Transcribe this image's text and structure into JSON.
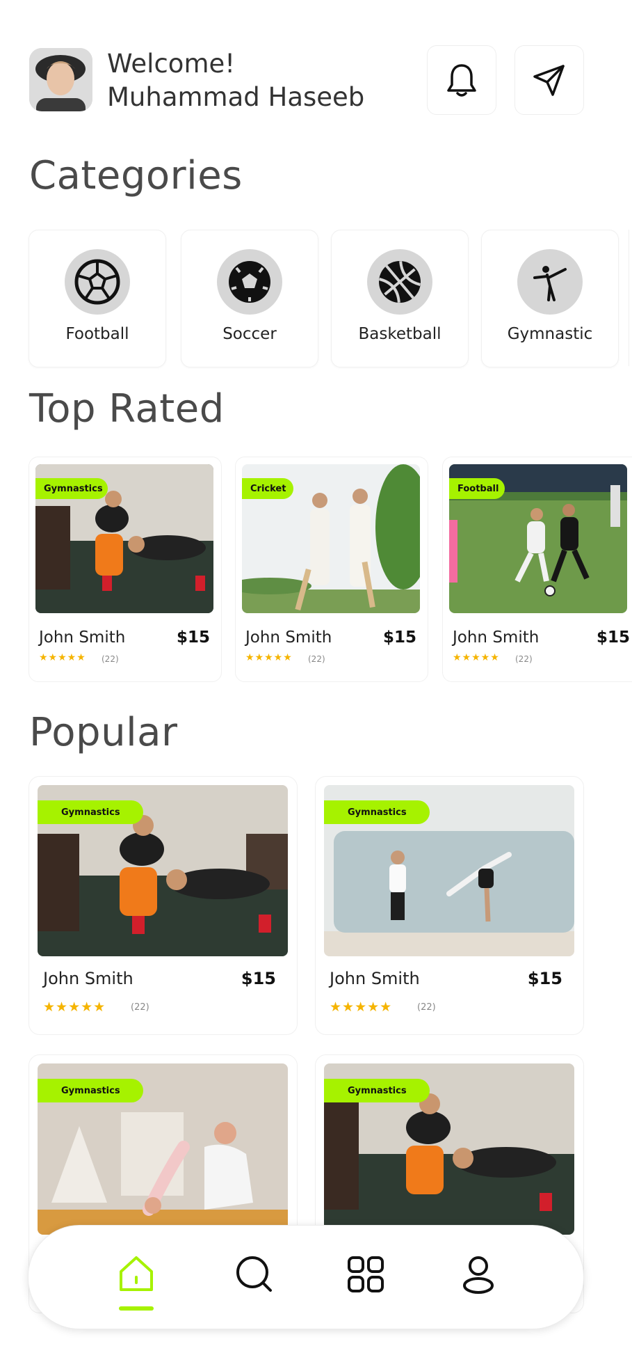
{
  "header": {
    "welcome": "Welcome!",
    "username": "Muhammad Haseeb"
  },
  "sections": {
    "categories": "Categories",
    "top_rated": "Top Rated",
    "popular": "Popular"
  },
  "categories": [
    {
      "label": "Football",
      "icon": "football-icon"
    },
    {
      "label": "Soccer",
      "icon": "soccer-ball-icon"
    },
    {
      "label": "Basketball",
      "icon": "basketball-icon"
    },
    {
      "label": "Gymnastic",
      "icon": "gymnast-icon"
    }
  ],
  "top_rated": [
    {
      "tag": "Gymnastics",
      "name": "John Smith",
      "price": "$15",
      "stars": "★★★★★",
      "count": "(22)"
    },
    {
      "tag": "Cricket",
      "name": "John Smith",
      "price": "$15",
      "stars": "★★★★★",
      "count": "(22)"
    },
    {
      "tag": "Football",
      "name": "John Smith",
      "price": "$15",
      "stars": "★★★★★",
      "count": "(22)"
    }
  ],
  "popular": [
    {
      "tag": "Gymnastics",
      "name": "John Smith",
      "price": "$15",
      "stars": "★★★★★",
      "count": "(22)"
    },
    {
      "tag": "Gymnastics",
      "name": "John Smith",
      "price": "$15",
      "stars": "★★★★★",
      "count": "(22)"
    },
    {
      "tag": "Gymnastics"
    },
    {
      "tag": "Gymnastics"
    }
  ],
  "nav": {
    "items": [
      "home-icon",
      "search-icon",
      "grid-icon",
      "profile-icon"
    ],
    "active": "home"
  },
  "colors": {
    "accent": "#a6f200",
    "star": "#f5b400",
    "title": "#4a4a4a"
  }
}
